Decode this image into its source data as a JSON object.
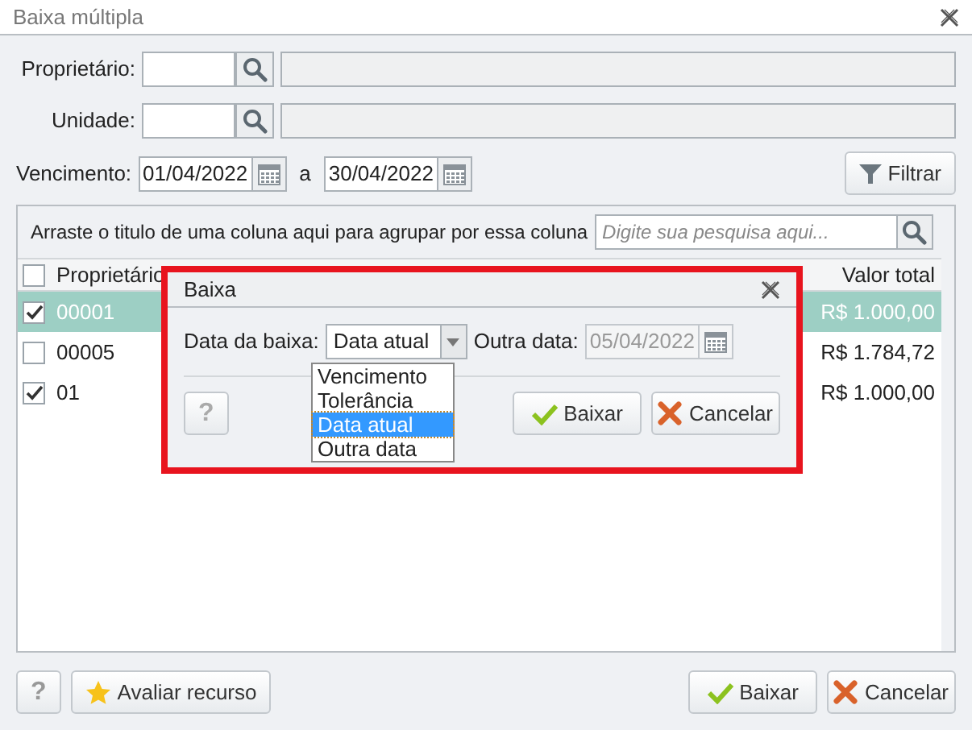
{
  "window": {
    "title": "Baixa múltipla"
  },
  "filters": {
    "owner_label": "Proprietário:",
    "unit_label": "Unidade:",
    "due_label": "Vencimento:",
    "due_from": "01/04/2022",
    "due_separator": "a",
    "due_to": "30/04/2022",
    "filter_button": "Filtrar"
  },
  "grid": {
    "group_hint": "Arraste o titulo de uma coluna aqui para agrupar por essa coluna",
    "search_placeholder": "Digite sua pesquisa aqui...",
    "select_all_checked": false,
    "columns": [
      "Proprietário",
      "Valor total"
    ],
    "rows": [
      {
        "owner": "00001",
        "total": "R$ 1.000,00",
        "checked": true,
        "selected": true
      },
      {
        "owner": "00005",
        "total": "R$ 1.784,72",
        "checked": false,
        "selected": false
      },
      {
        "owner": "01",
        "total": "R$ 1.000,00",
        "checked": true,
        "selected": false
      }
    ]
  },
  "dialog": {
    "title": "Baixa",
    "date_label": "Data da baixa:",
    "date_value": "Data atual",
    "other_label": "Outra data:",
    "other_value": "05/04/2022",
    "options": [
      {
        "label": "Vencimento",
        "selected": false
      },
      {
        "label": "Tolerância",
        "selected": false
      },
      {
        "label": "Data atual",
        "selected": true
      },
      {
        "label": "Outra data",
        "selected": false
      }
    ],
    "help": "?",
    "confirm": "Baixar",
    "cancel": "Cancelar"
  },
  "footer": {
    "help": "?",
    "rate": "Avaliar recurso",
    "confirm": "Baixar",
    "cancel": "Cancelar"
  }
}
